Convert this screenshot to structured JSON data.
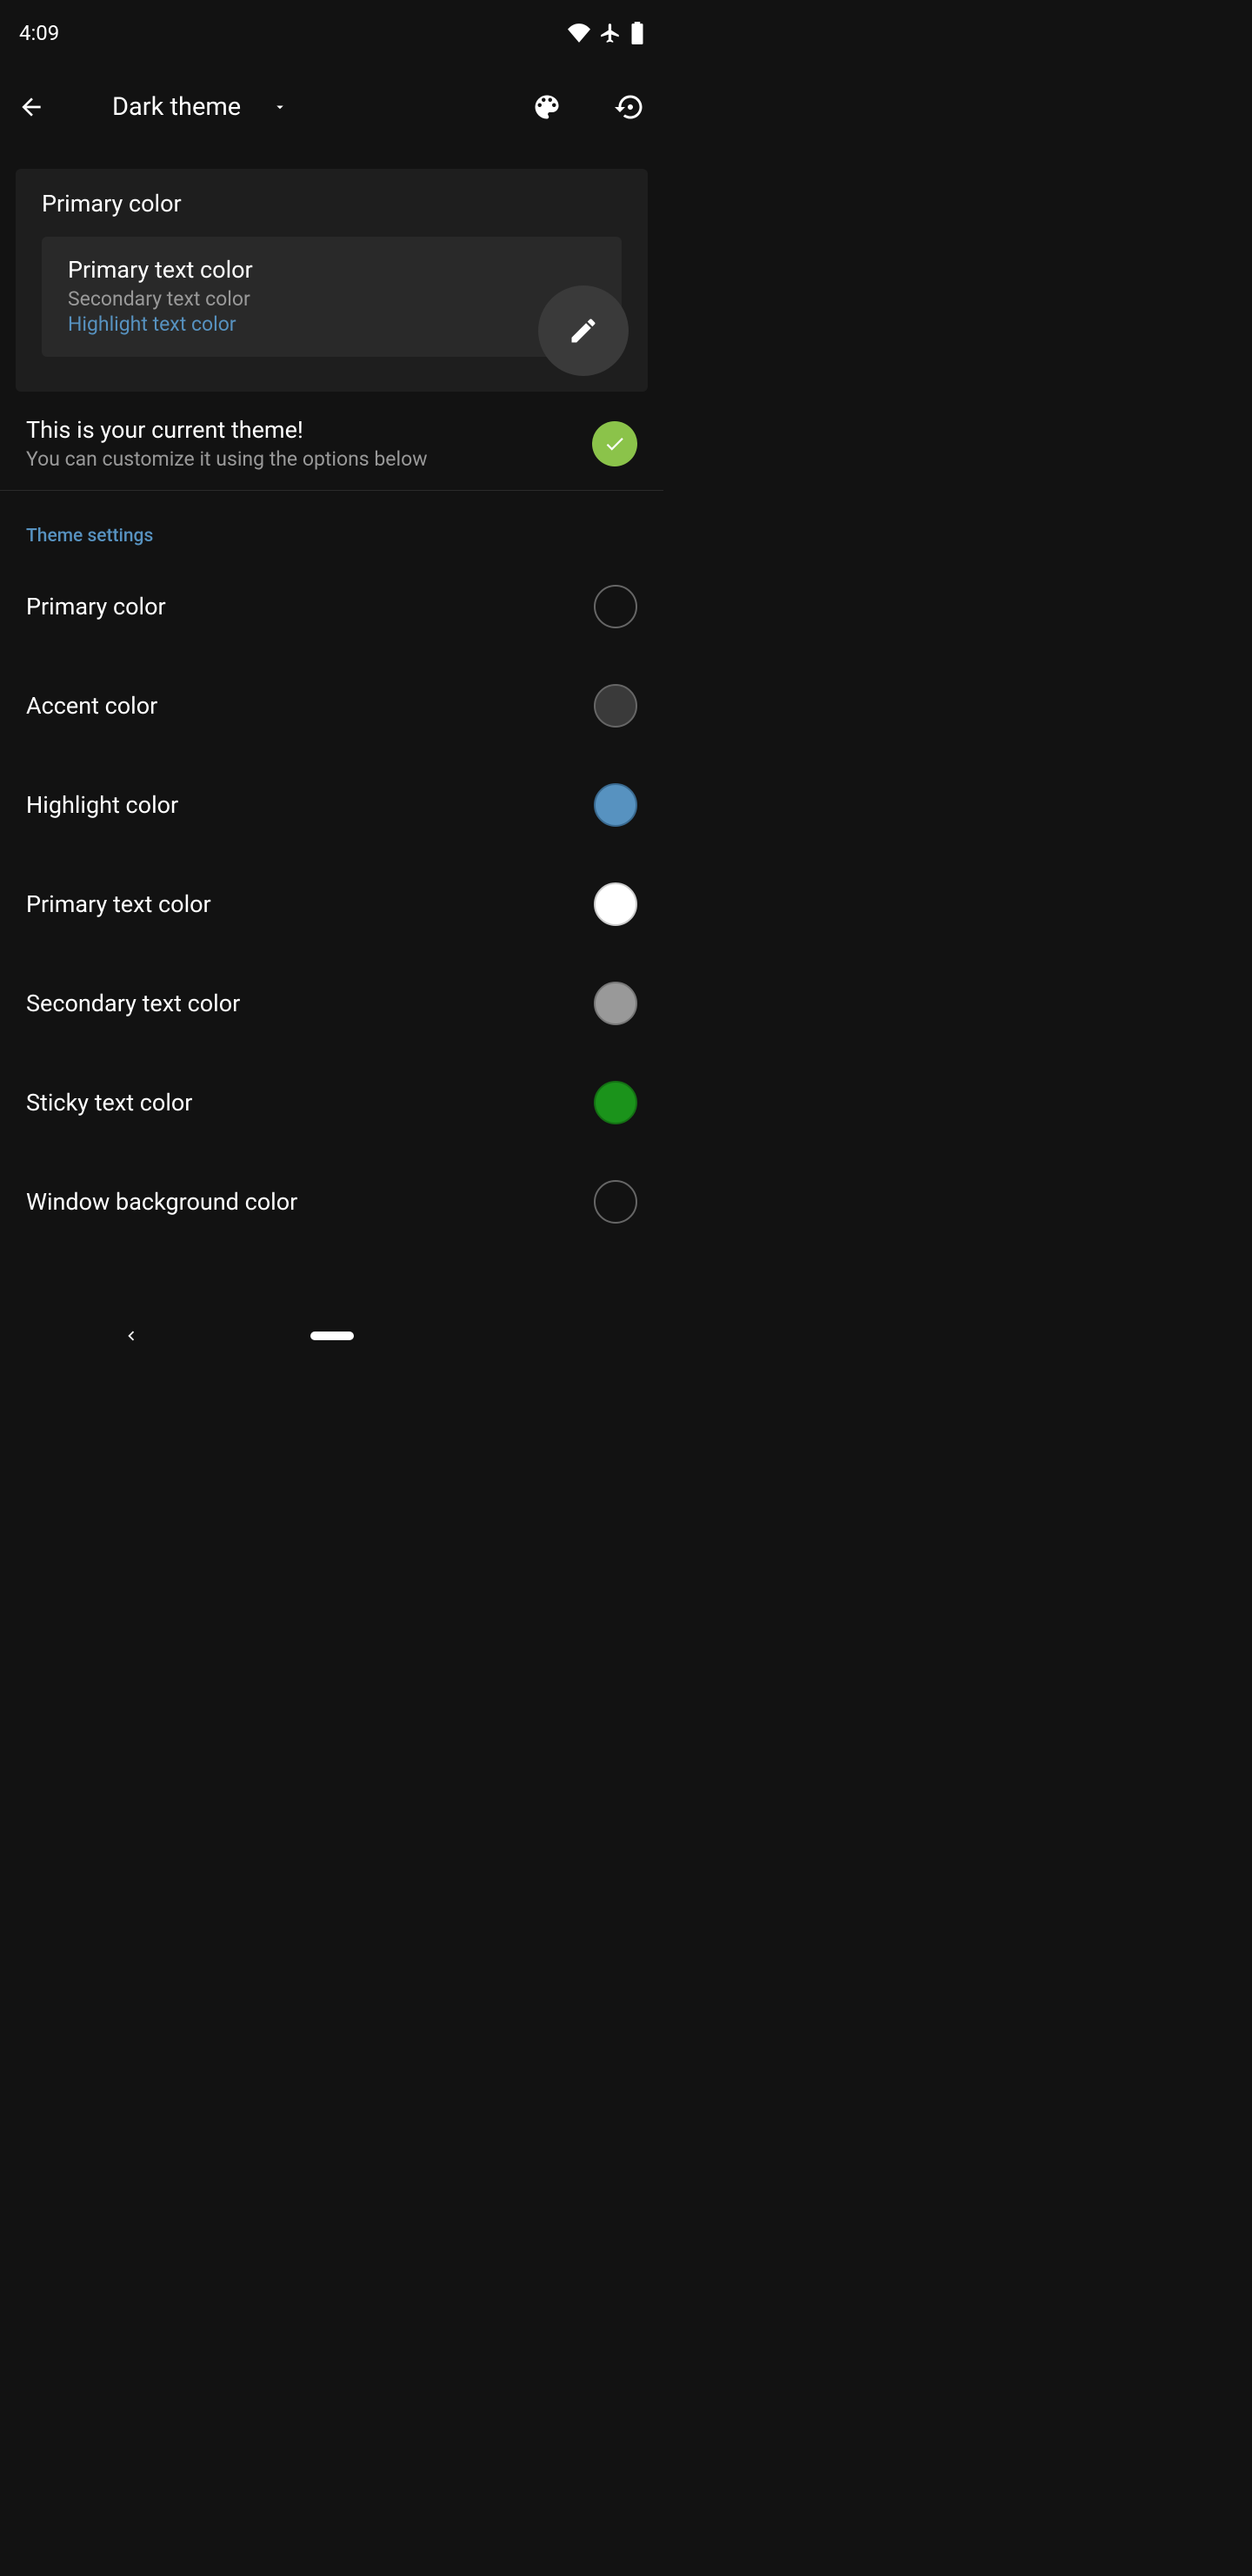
{
  "status_bar": {
    "time": "4:09"
  },
  "app_bar": {
    "title": "Dark theme"
  },
  "preview_card": {
    "header": "Primary color",
    "primary_text": "Primary text color",
    "secondary_text": "Secondary text color",
    "highlight_text": "Highlight text color"
  },
  "current_theme": {
    "title": "This is your current theme!",
    "subtitle": "You can customize it using the options below"
  },
  "section_title": "Theme settings",
  "settings": [
    {
      "label": "Primary color",
      "swatch": "#121212",
      "border": "#666666"
    },
    {
      "label": "Accent color",
      "swatch": "#3a3a3a",
      "border": "#666666"
    },
    {
      "label": "Highlight color",
      "swatch": "#5792c0",
      "border": "#3a6a90"
    },
    {
      "label": "Primary text color",
      "swatch": "#ffffff",
      "border": "#cccccc"
    },
    {
      "label": "Secondary text color",
      "swatch": "#999999",
      "border": "#777777"
    },
    {
      "label": "Sticky text color",
      "swatch": "#1b931b",
      "border": "#147014"
    },
    {
      "label": "Window background color",
      "swatch": "#121212",
      "border": "#666666"
    }
  ]
}
